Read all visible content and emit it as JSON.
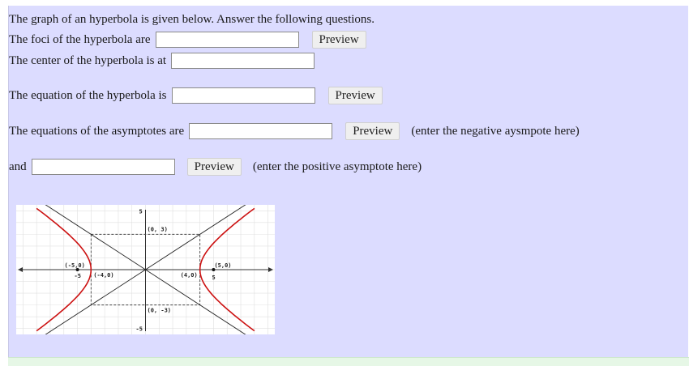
{
  "intro": "The graph of an hyperbola is given below. Answer the following questions.",
  "foci_label": "The foci of the hyperbola are",
  "center_label": "The center of the hyperbola is at",
  "equation_label": "The equation of the hyperbola is",
  "asymptotes_label": "The equations of the asymptotes are",
  "and_label": "and",
  "preview_label": "Preview",
  "neg_hint": "(enter the negative aysmpote here)",
  "pos_hint": "(enter the positive asymptote here)",
  "inputs": {
    "foci": "",
    "center": "",
    "equation": "",
    "asymptote_neg": "",
    "asymptote_pos": ""
  },
  "graph": {
    "labels": {
      "top_vertex": "(0, 3)",
      "bottom_vertex": "(0, -3)",
      "left_focus": "(-5,0)",
      "right_focus": "(5,0)",
      "left_vertex": "(-4,0)",
      "right_vertex": "(4,0)",
      "tick_pos5_y": "5",
      "tick_neg5_y": "-5",
      "tick_neg5_x": "-5",
      "tick_pos5_x": "5"
    },
    "a": 4,
    "b": 3,
    "c": 5,
    "x_range": [
      -9.5,
      9.5
    ],
    "y_range": [
      -5.5,
      5.5
    ],
    "colors": {
      "curve": "#cc1111",
      "axes": "#333333",
      "grid": "#e0e0e0",
      "box": "#444444"
    }
  }
}
